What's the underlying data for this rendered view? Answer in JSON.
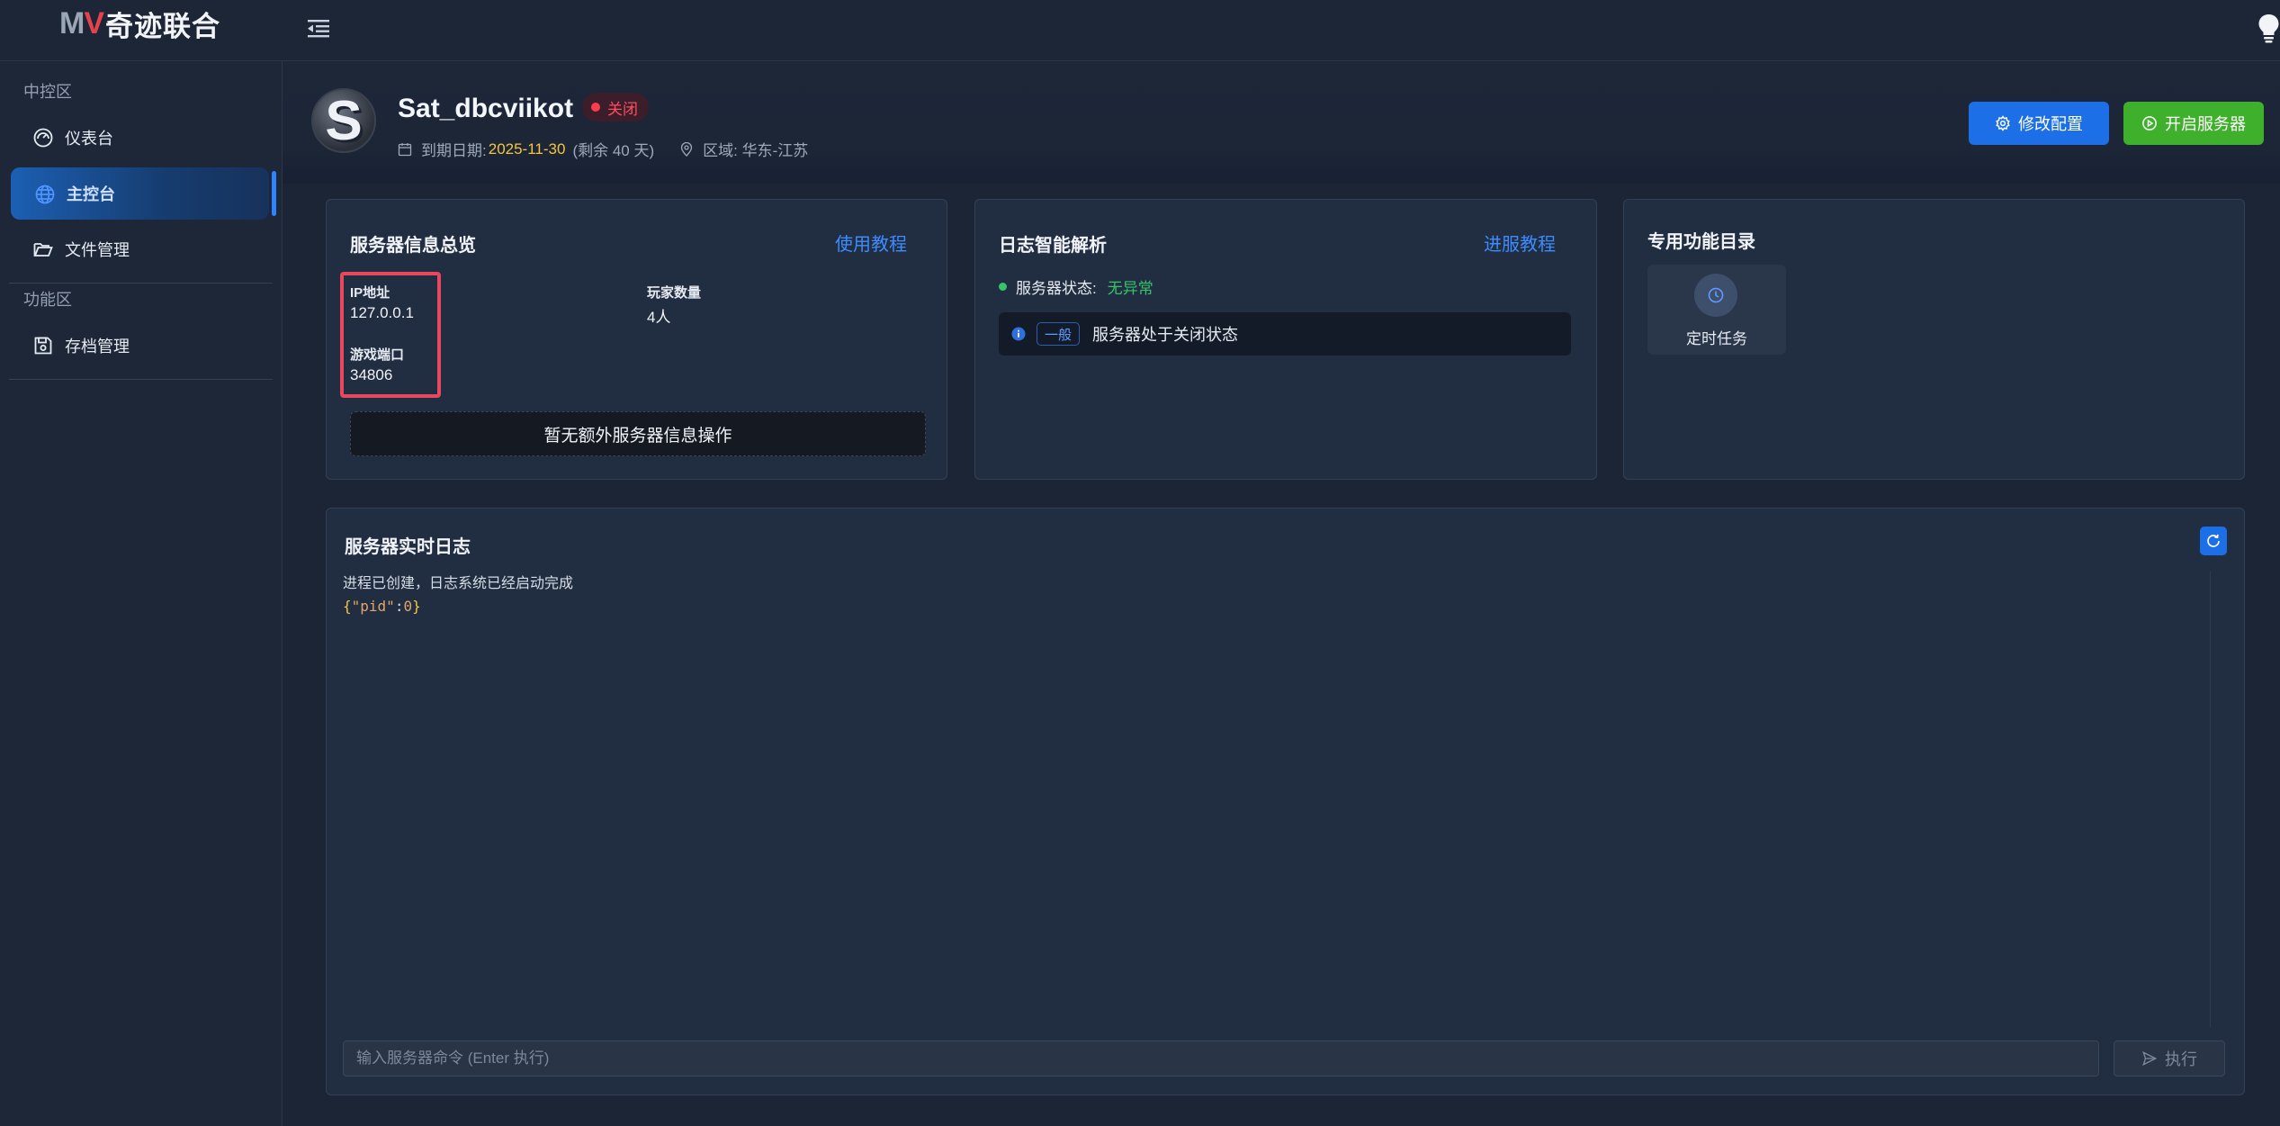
{
  "app": {
    "logo_mark_m": "M",
    "logo_mark_v": "V",
    "logo_text": "奇迹联合"
  },
  "sidebar": {
    "sections": [
      {
        "title": "中控区",
        "items": [
          {
            "label": "仪表台",
            "icon": "dashboard-icon",
            "active": false
          },
          {
            "label": "主控台",
            "icon": "globe-icon",
            "active": true
          },
          {
            "label": "文件管理",
            "icon": "folder-icon",
            "active": false
          }
        ]
      },
      {
        "title": "功能区",
        "items": [
          {
            "label": "存档管理",
            "icon": "save-icon",
            "active": false
          }
        ]
      }
    ]
  },
  "server": {
    "avatar_letter": "S",
    "name": "Sat_dbcviikot",
    "status": "关闭",
    "status_color": "#ff4d5e",
    "expire_label": "到期日期:",
    "expire_date": "2025-11-30",
    "remaining": "(剩余 40 天)",
    "region": "区域: 华东-江苏"
  },
  "actions": {
    "config_label": "修改配置",
    "start_label": "开启服务器"
  },
  "overview": {
    "title": "服务器信息总览",
    "tutorial_link": "使用教程",
    "ip_label": "IP地址",
    "ip_value": "127.0.0.1",
    "port_label": "游戏端口",
    "port_value": "34806",
    "players_label": "玩家数量",
    "players_value": "4人",
    "noop_label": "暂无额外服务器信息操作"
  },
  "log_analysis": {
    "title": "日志智能解析",
    "tutorial_link": "进服教程",
    "status_label": "服务器状态:",
    "status_value": "无异常",
    "entry_tag": "一般",
    "entry_message": "服务器处于关闭状态"
  },
  "features": {
    "title": "专用功能目录",
    "items": [
      {
        "label": "定时任务",
        "icon": "clock-icon"
      }
    ]
  },
  "realtime_log": {
    "title": "服务器实时日志",
    "lines": [
      "进程已创建，日志系统已经启动完成"
    ],
    "json_brace_open": "{",
    "json_key": "\"pid\"",
    "json_colon": ":",
    "json_value": "0",
    "json_brace_close": "}",
    "input_placeholder": "输入服务器命令 (Enter 执行)",
    "exec_label": "执行"
  },
  "colors": {
    "accent": "#1d6fe8",
    "success": "#3fb02b",
    "danger": "#ff4d5e",
    "warning_date": "#f5c542"
  }
}
